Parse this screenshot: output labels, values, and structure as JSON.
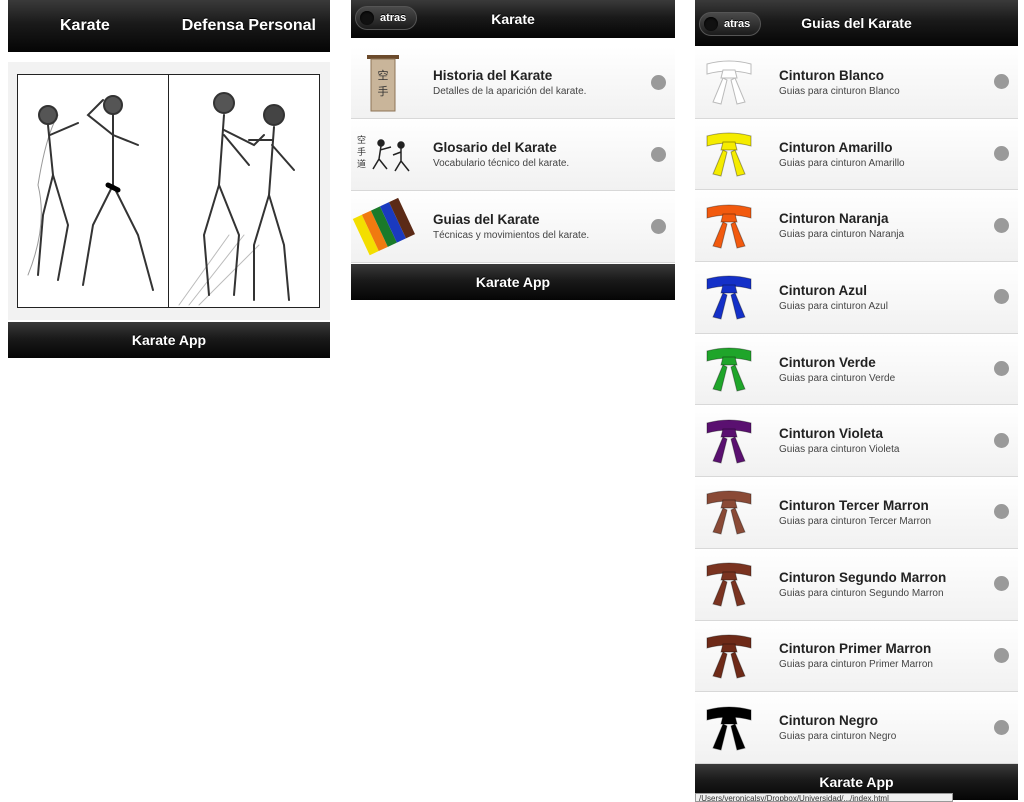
{
  "screen_home": {
    "tabs": [
      "Karate",
      "Defensa Personal"
    ],
    "footer": "Karate App"
  },
  "screen_menu": {
    "back_label": "atras",
    "title": "Karate",
    "items": [
      {
        "title": "Historia del Karate",
        "subtitle": "Detalles de la aparición del karate.",
        "icon": "scroll-icon"
      },
      {
        "title": "Glosario del Karate",
        "subtitle": "Vocabulario técnico del karate.",
        "icon": "fighters-icon"
      },
      {
        "title": "Guias del Karate",
        "subtitle": "Técnicas y movimientos del karate.",
        "icon": "belts-icon"
      }
    ],
    "footer": "Karate App"
  },
  "screen_guides": {
    "back_label": "atras",
    "title": "Guias del Karate",
    "belts": [
      {
        "title": "Cinturon Blanco",
        "subtitle": "Guias para cinturon Blanco",
        "color": "#ffffff"
      },
      {
        "title": "Cinturon Amarillo",
        "subtitle": "Guias para cinturon Amarillo",
        "color": "#f5ec00"
      },
      {
        "title": "Cinturon Naranja",
        "subtitle": "Guias para cinturon Naranja",
        "color": "#f25a0f"
      },
      {
        "title": "Cinturon Azul",
        "subtitle": "Guias para cinturon Azul",
        "color": "#1430c8"
      },
      {
        "title": "Cinturon Verde",
        "subtitle": "Guias para cinturon Verde",
        "color": "#1fa52a"
      },
      {
        "title": "Cinturon Violeta",
        "subtitle": "Guias para cinturon Violeta",
        "color": "#5a1070"
      },
      {
        "title": "Cinturon Tercer Marron",
        "subtitle": "Guias para cinturon Tercer Marron",
        "color": "#8a4a36"
      },
      {
        "title": "Cinturon Segundo Marron",
        "subtitle": "Guias para cinturon Segundo Marron",
        "color": "#7a3320"
      },
      {
        "title": "Cinturon Primer Marron",
        "subtitle": "Guias para cinturon Primer Marron",
        "color": "#6e2a18"
      },
      {
        "title": "Cinturon Negro",
        "subtitle": "Guias para cinturon Negro",
        "color": "#000000"
      }
    ],
    "footer": "Karate App",
    "url_text": "/Users/veronicalsy/Dropbox/Universidad/.../index.html"
  }
}
